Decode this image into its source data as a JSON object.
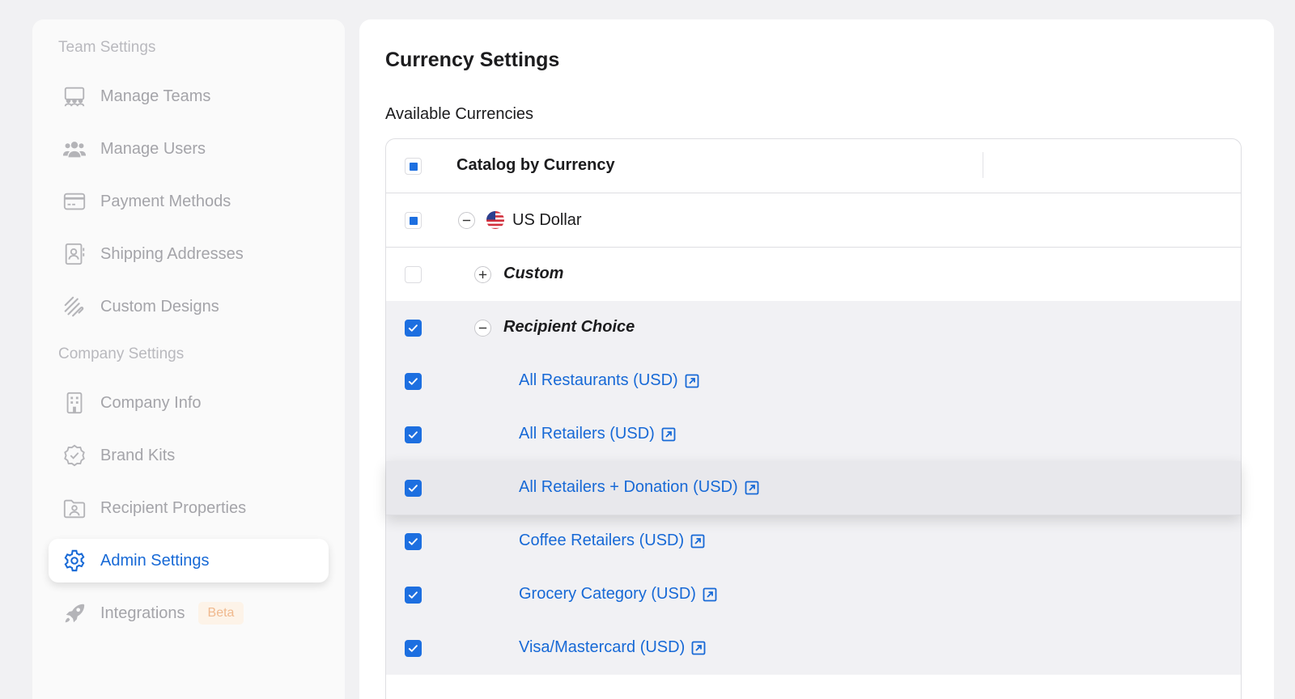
{
  "sidebar": {
    "team_section": "Team Settings",
    "company_section": "Company Settings",
    "items": [
      {
        "label": "Manage Teams",
        "icon": "teams-icon"
      },
      {
        "label": "Manage Users",
        "icon": "users-icon"
      },
      {
        "label": "Payment Methods",
        "icon": "credit-card-icon"
      },
      {
        "label": "Shipping Addresses",
        "icon": "address-book-icon"
      },
      {
        "label": "Custom Designs",
        "icon": "scribble-icon"
      },
      {
        "label": "Company Info",
        "icon": "building-icon"
      },
      {
        "label": "Brand Kits",
        "icon": "badge-check-icon"
      },
      {
        "label": "Recipient Properties",
        "icon": "folder-user-icon"
      },
      {
        "label": "Admin Settings",
        "icon": "gear-icon",
        "active": true
      },
      {
        "label": "Integrations",
        "icon": "rocket-icon",
        "badge": "Beta"
      }
    ]
  },
  "main": {
    "title": "Currency Settings",
    "subtitle": "Available Currencies",
    "table": {
      "header": "Catalog by Currency",
      "currency": "US Dollar",
      "groups": [
        "Custom",
        "Recipient Choice"
      ],
      "catalogs": [
        "All Restaurants (USD)",
        "All Retailers (USD)",
        "All Retailers + Donation (USD)",
        "Coffee Retailers (USD)",
        "Grocery Category (USD)",
        "Visa/Mastercard (USD)"
      ]
    }
  },
  "colors": {
    "accent": "#1d6fe0",
    "link": "#1769d6",
    "muted_text": "#a4a4a9",
    "badge_bg": "#fdf3e8",
    "badge_text": "#f0b98e"
  }
}
